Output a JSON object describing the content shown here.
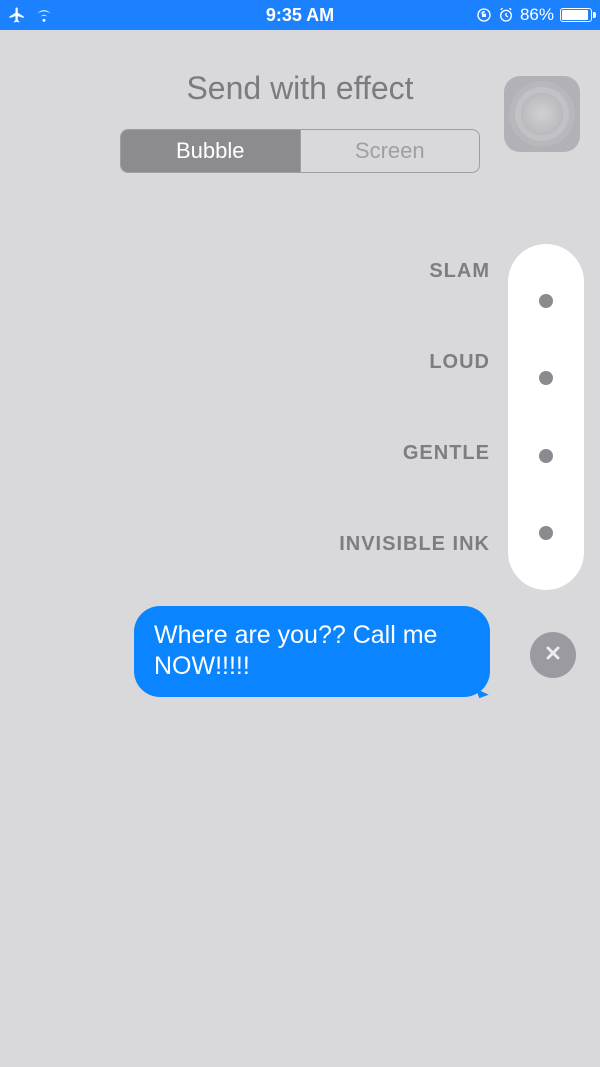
{
  "status_bar": {
    "time": "9:35 AM",
    "battery_percent": "86%",
    "icons": {
      "airplane": "airplane-mode-icon",
      "wifi": "wifi-icon",
      "orientation_lock": "orientation-lock-icon",
      "alarm": "alarm-icon",
      "battery": "battery-icon"
    }
  },
  "header": {
    "title": "Send with effect",
    "segmented": {
      "bubble": "Bubble",
      "screen": "Screen",
      "active": "bubble"
    }
  },
  "effects": [
    {
      "label": "SLAM"
    },
    {
      "label": "LOUD"
    },
    {
      "label": "GENTLE"
    },
    {
      "label": "INVISIBLE INK"
    }
  ],
  "message": {
    "text": "Where are you?? Call me NOW!!!!!"
  },
  "cancel_button": {
    "name": "cancel"
  }
}
